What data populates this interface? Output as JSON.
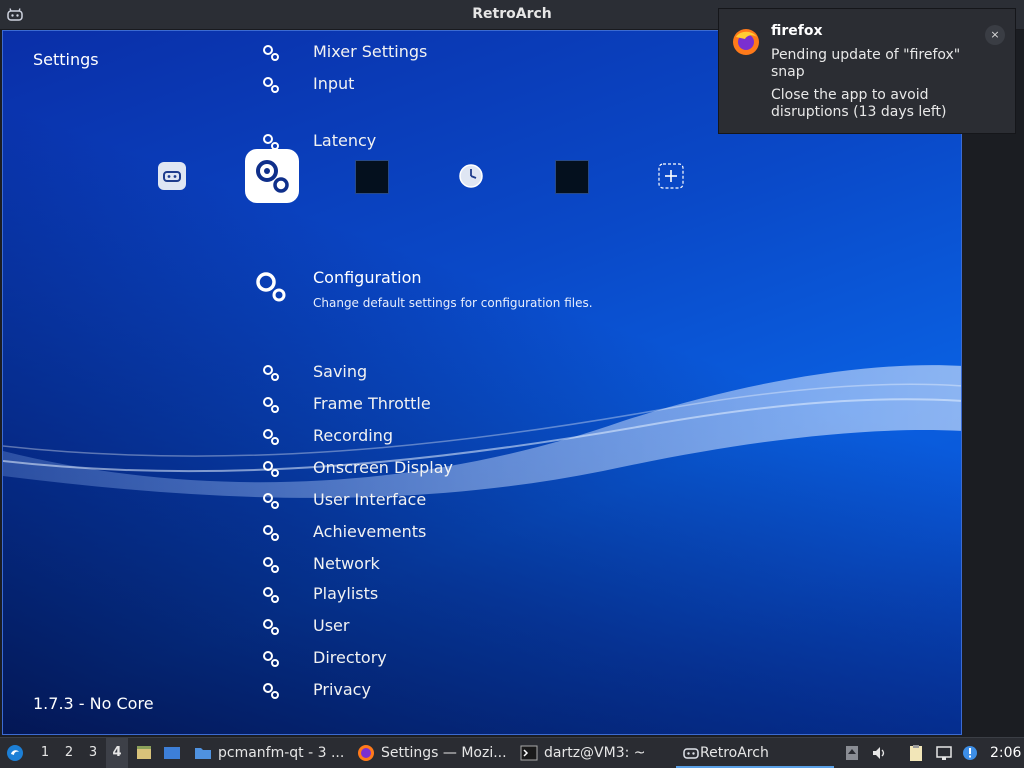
{
  "window": {
    "title": "RetroArch"
  },
  "menu": {
    "header_label": "Settings",
    "footer_label": "1.7.3 - No Core",
    "items_top": [
      {
        "label": "Mixer Settings"
      },
      {
        "label": "Input"
      },
      {
        "label": "Latency"
      }
    ],
    "selected": {
      "label": "Configuration",
      "sublabel": "Change default settings for configuration files."
    },
    "items_bottom": [
      {
        "label": "Saving"
      },
      {
        "label": "Frame Throttle"
      },
      {
        "label": "Recording"
      },
      {
        "label": "Onscreen Display"
      },
      {
        "label": "User Interface"
      },
      {
        "label": "Achievements"
      },
      {
        "label": "Network"
      },
      {
        "label": "Playlists"
      },
      {
        "label": "User"
      },
      {
        "label": "Directory"
      },
      {
        "label": "Privacy"
      }
    ],
    "tabs": [
      {
        "icon": "retroarch-main-icon"
      },
      {
        "icon": "settings-gear-icon",
        "active": true
      },
      {
        "icon": "history-black-thumb-icon"
      },
      {
        "icon": "clock-icon"
      },
      {
        "icon": "favorites-black-thumb-icon"
      },
      {
        "icon": "add-icon"
      }
    ]
  },
  "notification": {
    "app": "firefox",
    "summary": "Pending update of \"firefox\" snap",
    "body": "Close the app to avoid disruptions (13 days left)",
    "close_label": "×"
  },
  "taskbar": {
    "workspaces": [
      "1",
      "2",
      "3",
      "4"
    ],
    "active_workspace": "4",
    "tasks": [
      {
        "label": "pcmanfm-qt - 3 ...",
        "icon": "folder-icon"
      },
      {
        "label": "Settings — Mozi...",
        "icon": "firefox-icon"
      },
      {
        "label": "dartz@VM3: ~",
        "icon": "terminal-icon"
      },
      {
        "label": "RetroArch",
        "icon": "retroarch-icon"
      }
    ],
    "clock": "2:06"
  },
  "colors": {
    "accent": "#5aa0e6",
    "background_top": "#0a2fa8",
    "background_mid": "#0a5fe0"
  }
}
